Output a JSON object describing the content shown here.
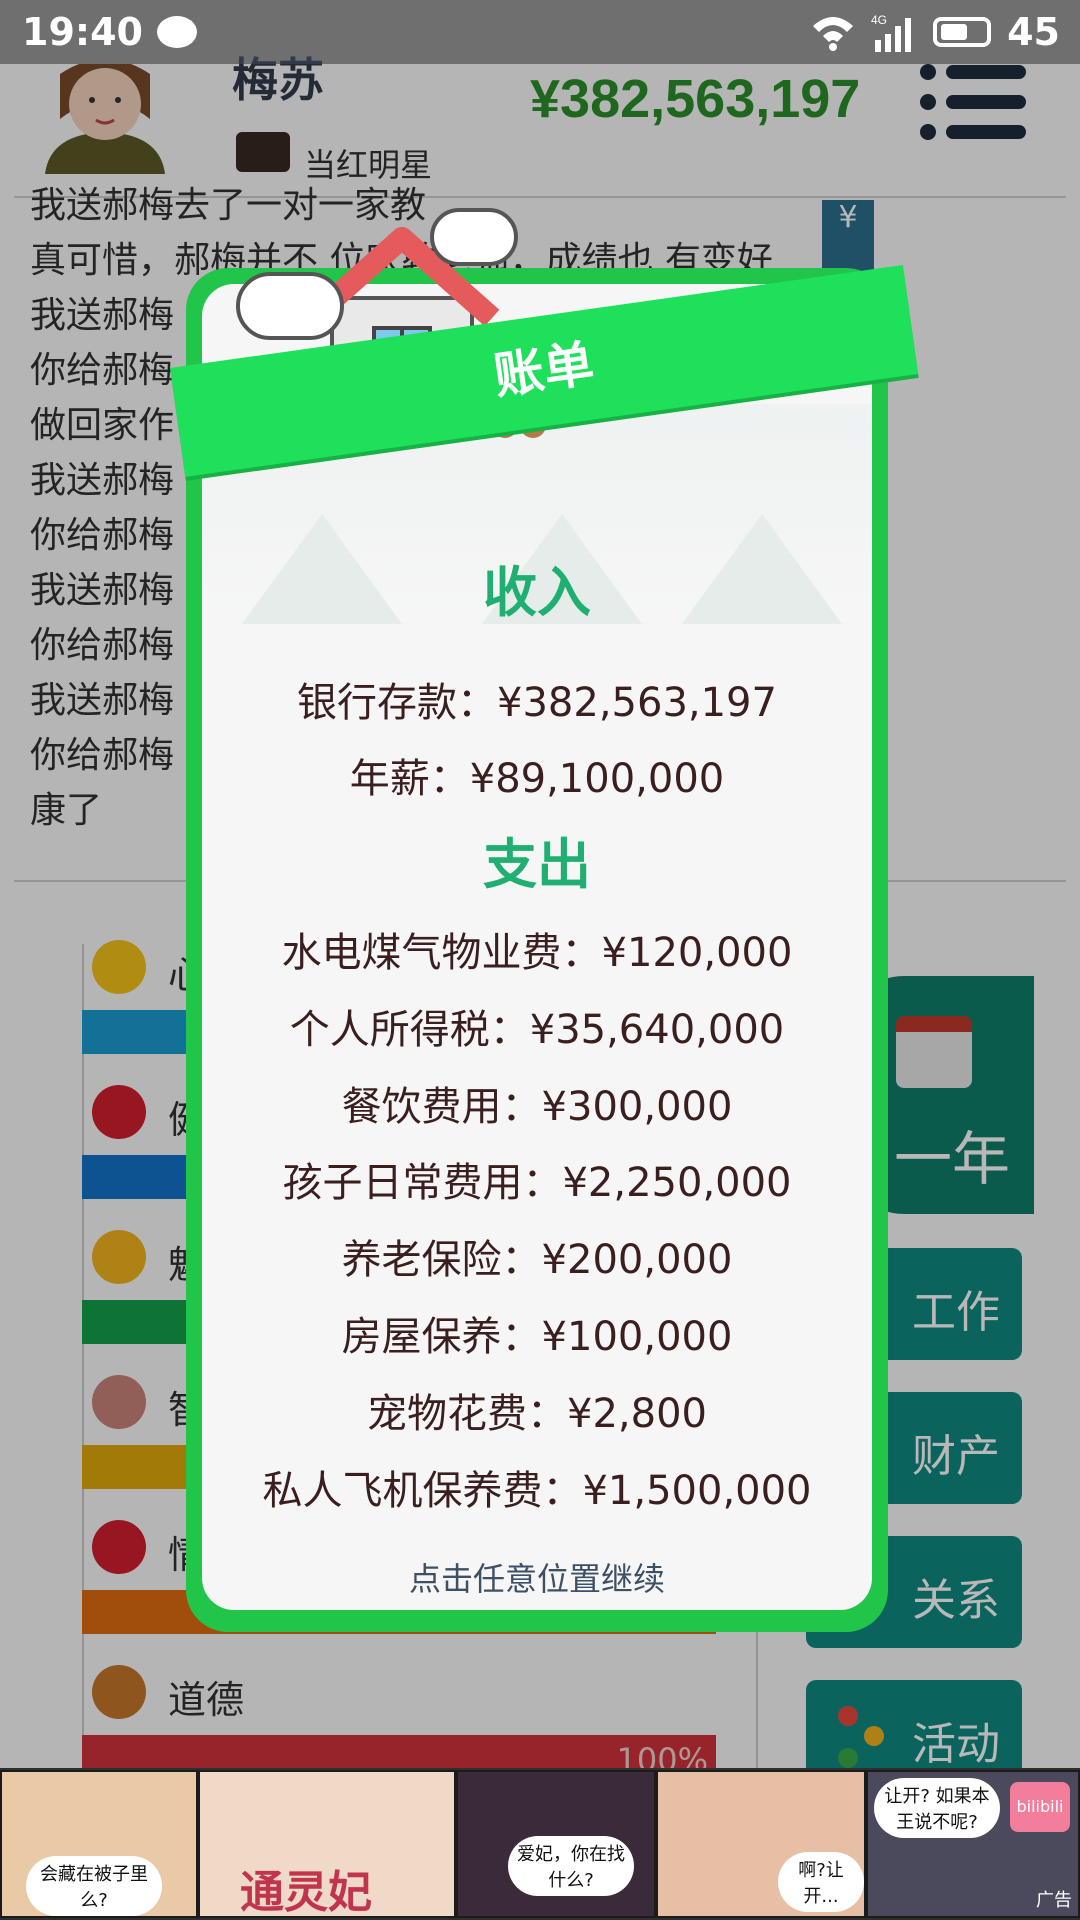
{
  "status_bar": {
    "time": "19:40",
    "network": "4G",
    "battery": "45"
  },
  "profile": {
    "name": "梅苏",
    "job": "当红明星",
    "money": "¥382,563,197"
  },
  "log_lines": [
    "我送郝梅去了一对一家教",
    "真可惜，郝梅并不 位家教老师，成绩也 有变好",
    "我送郝梅",
    "你给郝梅 好了，",
    "做回家作",
    "我送郝梅",
    "你给郝梅",
    "我送郝梅",
    "你给郝梅",
    "我送郝梅",
    "你给郝梅 本也更健",
    "康了"
  ],
  "log_tag": "¥",
  "stats": [
    {
      "label": "心",
      "color": "#1b9bd1",
      "icon": "smiley-icon"
    },
    {
      "label": "健",
      "color": "#1473c9",
      "icon": "heart-icon"
    },
    {
      "label": "魅",
      "color": "#12a14a",
      "icon": "sun-icon"
    },
    {
      "label": "智",
      "color": "#e0a90c",
      "icon": "brain-icon"
    },
    {
      "label": "情",
      "color": "#e06b10",
      "icon": "apple-icon"
    },
    {
      "label": "道德",
      "color": "#d3323c",
      "icon": "scales-icon",
      "percent": "100%"
    }
  ],
  "side_buttons": {
    "year": "一年",
    "work": "工作",
    "property": "财产",
    "relations": "关系",
    "activity": "活动"
  },
  "dialog": {
    "title": "账单",
    "income_header": "收入",
    "income": [
      "银行存款：¥382,563,197",
      "年薪：¥89,100,000"
    ],
    "expense_header": "支出",
    "expenses": [
      "水电煤气物业费：¥120,000",
      "个人所得税：¥35,640,000",
      "餐饮费用：¥300,000",
      "孩子日常费用：¥2,250,000",
      "养老保险：¥200,000",
      "房屋保养：¥100,000",
      "宠物花费：¥2,800",
      "私人飞机保养费：¥1,500,000"
    ],
    "continue": "点击任意位置继续"
  },
  "ad": {
    "bubble1": "会藏在被子里么?",
    "brand": "通灵妃",
    "bubble2": "爱妃，你在找什么?",
    "bubble3": "啊?让开...",
    "bubble4": "让开? 如果本王说不呢?",
    "logo": "bilibili",
    "label": "广告"
  }
}
